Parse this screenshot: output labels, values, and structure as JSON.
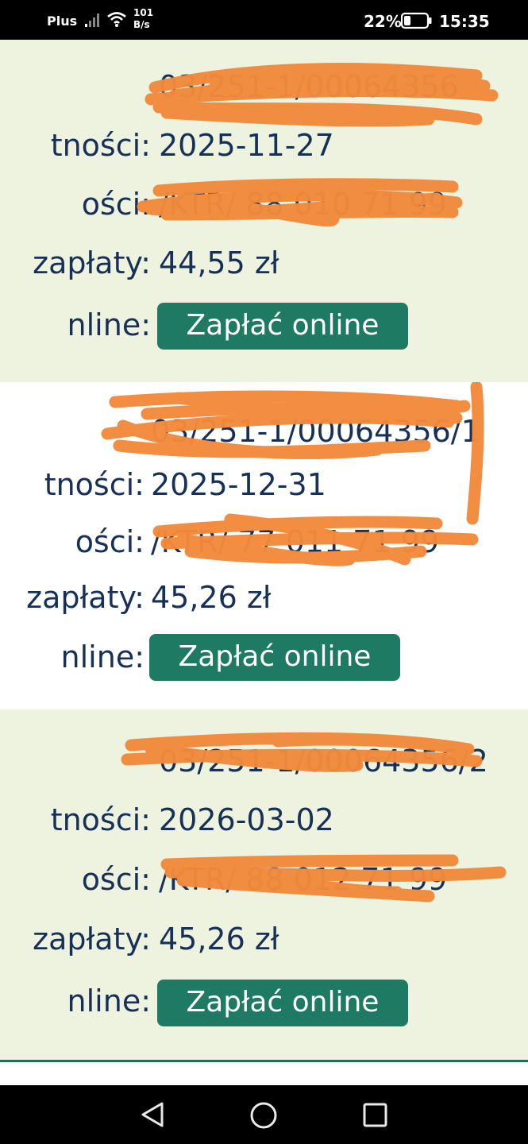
{
  "status_bar": {
    "carrier": "Plus",
    "net_rate_value": "101",
    "net_rate_unit": "B/s",
    "battery_percent": "22%",
    "time": "15:35",
    "icons": [
      "signal-icon",
      "wifi-icon",
      "battery-icon"
    ]
  },
  "invoices": [
    {
      "number": "03/251-1/00064356",
      "due_date_label": "tności:",
      "due_date": "2025-11-27",
      "title_label": "ości:",
      "title_value": "/KTR/ 88 010 71 99",
      "amount_label": "zapłaty:",
      "amount": "44,55 zł",
      "pay_label": "nline:",
      "pay_button": "Zapłać online"
    },
    {
      "number": "03/251-1/00064356/1",
      "due_date_label": "tności:",
      "due_date": "2025-12-31",
      "title_label": "ości:",
      "title_value": "/KTR/ 77 011 71 99",
      "amount_label": "zapłaty:",
      "amount": "45,26 zł",
      "pay_label": "nline:",
      "pay_button": "Zapłać online"
    },
    {
      "number": "03/251-1/00064356/2",
      "due_date_label": "tności:",
      "due_date": "2026-03-02",
      "title_label": "ości:",
      "title_value": "/KTR/ 88 012 71 99",
      "amount_label": "zapłaty:",
      "amount": "45,26 zł",
      "pay_label": "nline:",
      "pay_button": "Zapłać online"
    }
  ],
  "colors": {
    "card_alt_background": "#eef3df",
    "text": "#173058",
    "button": "#1f7a63",
    "redaction": "#f28a3c"
  },
  "nav_bar": {
    "icons": [
      "back-icon",
      "home-icon",
      "recents-icon"
    ]
  }
}
